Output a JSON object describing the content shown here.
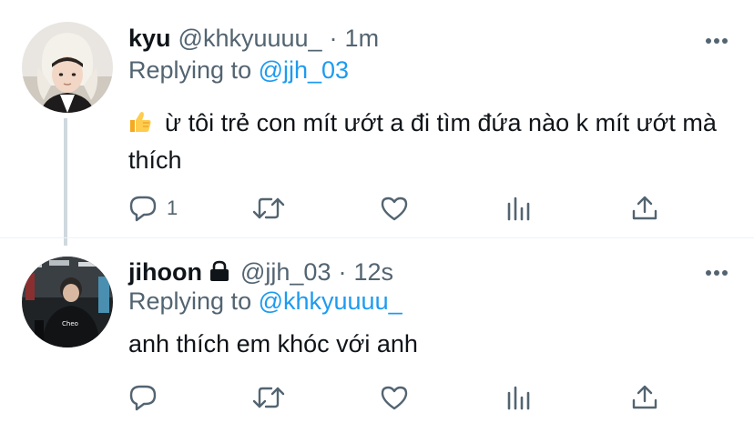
{
  "tweets": [
    {
      "name": "kyu",
      "handle": "@khkyuuuu_",
      "dot": "·",
      "time": "1m",
      "replying_prefix": "Replying to ",
      "replying_to": "@jjh_03",
      "text": "ừ tôi trẻ con mít ướt a đi tìm đứa nào k mít ướt mà thích",
      "emoji": "thumbs-up-icon",
      "reply_count": "1",
      "protected": false
    },
    {
      "name": "jihoon",
      "handle": "@jjh_03",
      "dot": "·",
      "time": "12s",
      "replying_prefix": "Replying to ",
      "replying_to": "@khkyuuuu_",
      "text": "anh thích em khóc với anh",
      "reply_count": "",
      "protected": true
    }
  ],
  "colors": {
    "text_primary": "#0f1419",
    "text_secondary": "#536471",
    "accent": "#1d9bf0",
    "thread_line": "#cfd9de"
  }
}
